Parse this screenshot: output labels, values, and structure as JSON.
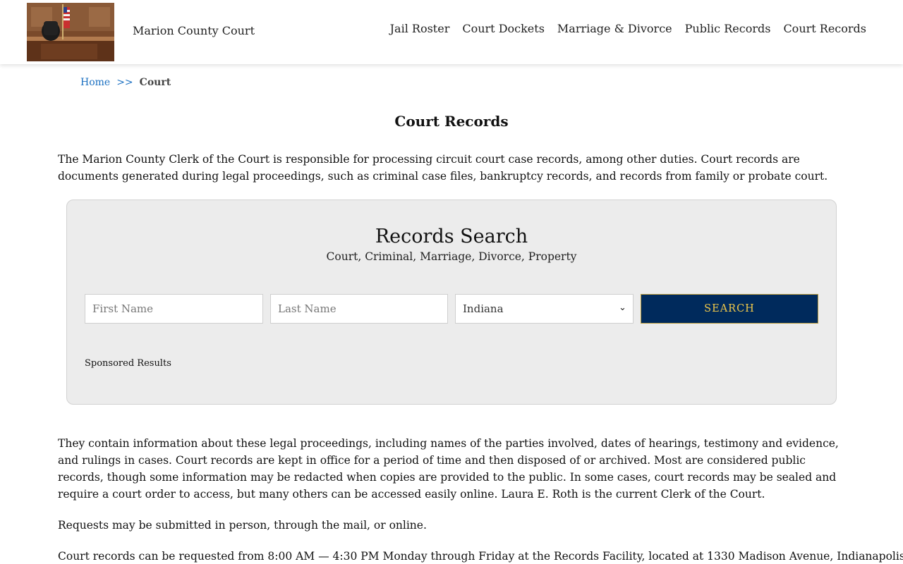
{
  "header": {
    "site_title": "Marion County Court",
    "nav": [
      "Jail Roster",
      "Court Dockets",
      "Marriage & Divorce",
      "Public Records",
      "Court Records"
    ]
  },
  "breadcrumb": {
    "home": "Home",
    "separator": ">>",
    "current": "Court"
  },
  "main": {
    "title": "Court Records",
    "intro": "The Marion County Clerk of the Court is responsible for processing circuit court case records, among other duties. Court records are documents generated during legal proceedings, such as criminal case files, bankruptcy records, and records from family or probate court.",
    "p2": "They contain information about these legal proceedings, including names of the parties involved, dates of hearings, testimony and evidence, and rulings in cases. Court records are kept in office for a period of time and then disposed of or archived. Most are considered public records, though some information may be redacted when copies are provided to the public. In some cases, court records may be sealed and require a court order to access, but many others can be accessed easily online. Laura E. Roth is the current Clerk of the Court.",
    "p3": "Requests may be submitted in person, through the mail, or online.",
    "p4": "Court records can be requested from 8:00 AM — 4:30 PM Monday through Friday at the Records Facility, located at 1330 Madison Avenue, Indianapolis,"
  },
  "search": {
    "title": "Records Search",
    "subtitle": "Court, Criminal, Marriage, Divorce, Property",
    "first_placeholder": "First Name",
    "last_placeholder": "Last Name",
    "state_value": "Indiana",
    "button_label": "SEARCH",
    "sponsored": "Sponsored Results"
  },
  "colors": {
    "button_bg": "#002a5c",
    "button_text": "#f0c84a",
    "link": "#1a6fc1",
    "panel_bg": "#ececec"
  },
  "icons": {
    "logo": "courtroom-logo-image",
    "select_arrow": "chevron-down-icon"
  }
}
